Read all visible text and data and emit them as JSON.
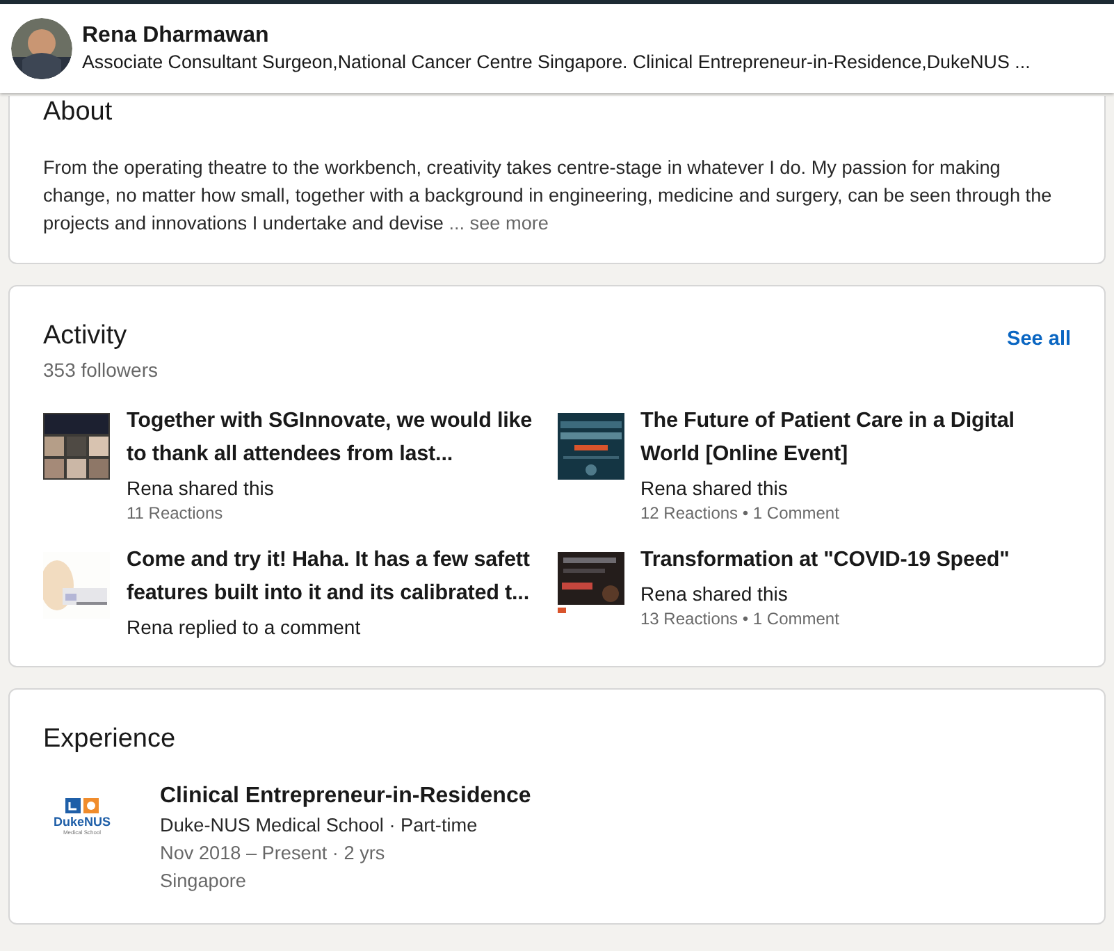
{
  "header": {
    "name": "Rena Dharmawan",
    "headline": "Associate Consultant Surgeon,National Cancer Centre Singapore. Clinical Entrepreneur-in-Residence,DukeNUS ..."
  },
  "about": {
    "title": "About",
    "text": "From the operating theatre to the workbench, creativity takes centre-stage in whatever I do. My passion for making change, no matter how small, together with a background in engineering, medicine and surgery, can be seen through the projects and innovations I undertake and devise",
    "more": "... see more"
  },
  "activity": {
    "title": "Activity",
    "followers": "353 followers",
    "see_all": "See all",
    "posts": [
      {
        "kind": "picture",
        "title": "Together with SGInnovate, we would like to thank all attendees from last...",
        "action": "Rena shared this",
        "stats": "11 Reactions"
      },
      {
        "kind": "picture",
        "title": "The Future of Patient Care in a Digital World [Online Event]",
        "action": "Rena shared this",
        "stats": "12 Reactions • 1 Comment"
      },
      {
        "kind": "picture",
        "title": "Come and try it! Haha. It has a few safett features built into it and its calibrated t...",
        "action": "Rena replied to a comment"
      },
      {
        "kind": "picture",
        "title": "Transformation at \"COVID-19 Speed\"",
        "action": "Rena shared this",
        "stats": "13 Reactions • 1 Comment"
      }
    ]
  },
  "experience": {
    "title": "Experience",
    "items": [
      {
        "logo_text": "DukeNUS",
        "logo_subtext": "Medical School",
        "title": "Clinical Entrepreneur-in-Residence",
        "company": "Duke-NUS Medical School · Part-time",
        "dates": "Nov 2018 – Present · 2 yrs",
        "location": "Singapore"
      }
    ]
  }
}
